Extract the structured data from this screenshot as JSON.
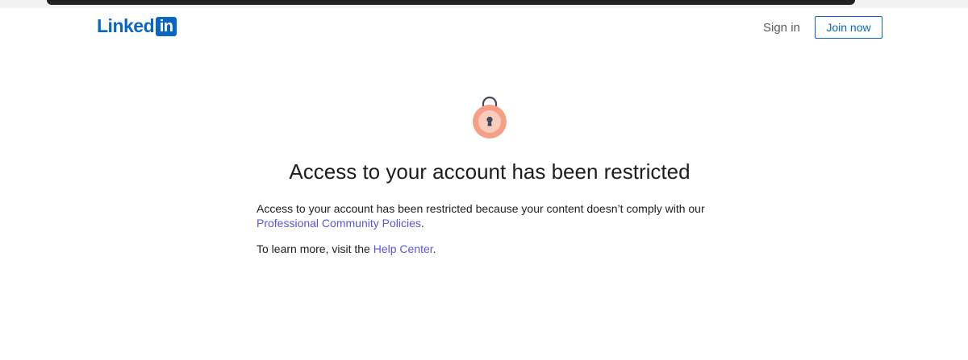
{
  "header": {
    "logo_word": "Linked",
    "logo_box": "in",
    "sign_in_label": "Sign in",
    "join_label": "Join now"
  },
  "main": {
    "title": "Access to your account has been restricted",
    "para1_text": "Access to your account has been restricted because your content doesn’t comply with our",
    "para1_link": "Professional Community Policies",
    "para1_end": ".",
    "para2_text": "To learn more, visit the",
    "para2_link": "Help Center",
    "para2_end": "."
  },
  "colors": {
    "brand": "#0a66c2",
    "link": "#5856d6",
    "lock_outer": "#f4a086",
    "lock_inner": "#f9cbbd",
    "shackle": "#3d4a5c"
  },
  "icons": {
    "lock": "lock-icon"
  }
}
